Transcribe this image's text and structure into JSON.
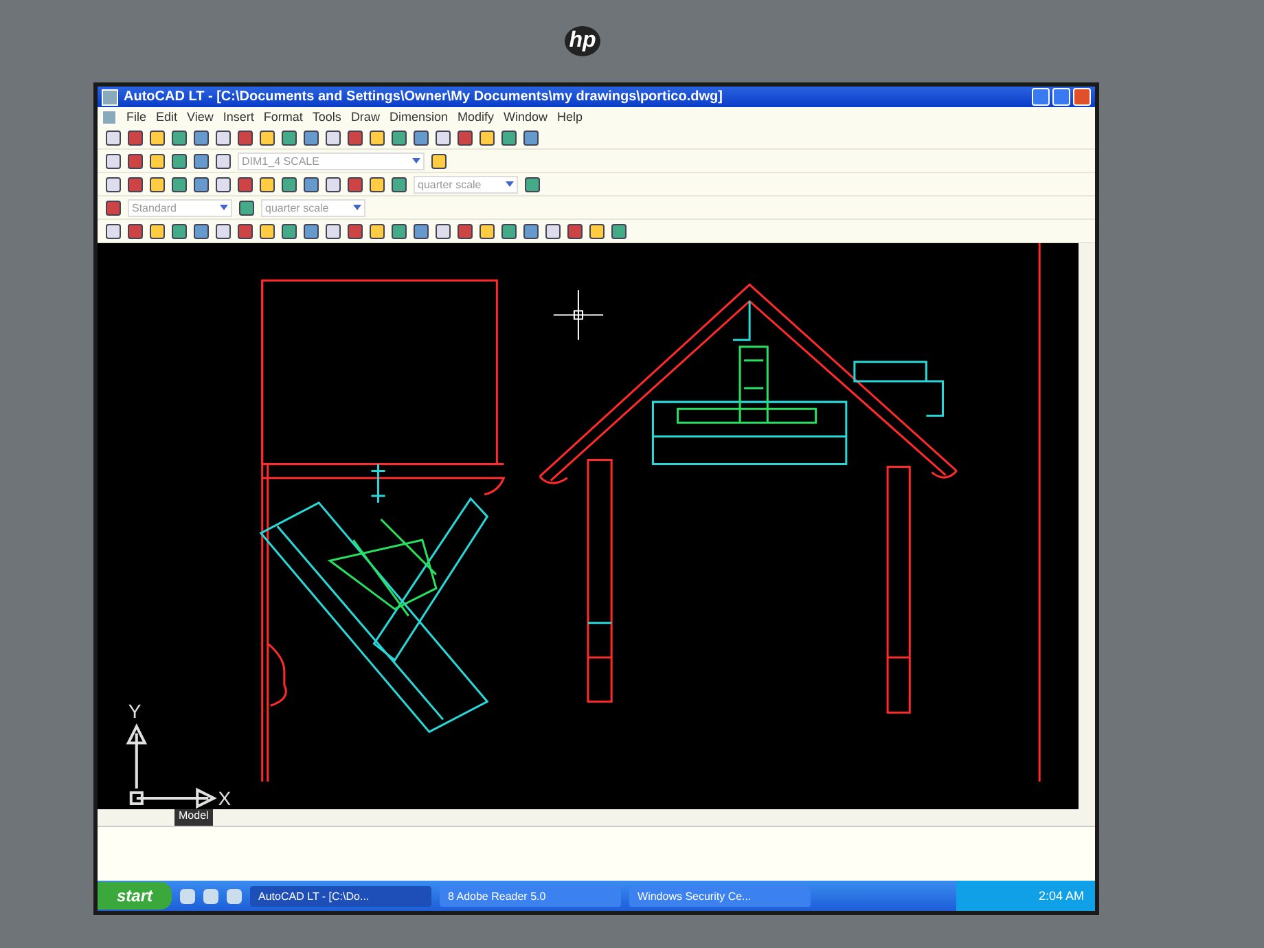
{
  "monitor": {
    "logo": "hp"
  },
  "window": {
    "title": "AutoCAD LT - [C:\\Documents and Settings\\Owner\\My Documents\\my drawings\\portico.dwg]"
  },
  "menu": [
    "File",
    "Edit",
    "View",
    "Insert",
    "Format",
    "Tools",
    "Draw",
    "Dimension",
    "Modify",
    "Window",
    "Help"
  ],
  "toolbars": {
    "layer": "DIM1_4 SCALE",
    "dim_style": "quarter scale",
    "text_style": "Standard",
    "dim_style_2": "quarter scale"
  },
  "drawing": {
    "axis_x": "X",
    "axis_y": "Y"
  },
  "tabs": [
    {
      "label": "Model",
      "selected": true
    }
  ],
  "taskbar": {
    "start": "start",
    "tasks": [
      {
        "label": "AutoCAD LT - [C:\\Do...",
        "selected": true
      },
      {
        "label": "8 Adobe Reader 5.0",
        "selected": false
      },
      {
        "label": "Windows Security Ce...",
        "selected": false
      }
    ],
    "clock": "2:04 AM"
  }
}
